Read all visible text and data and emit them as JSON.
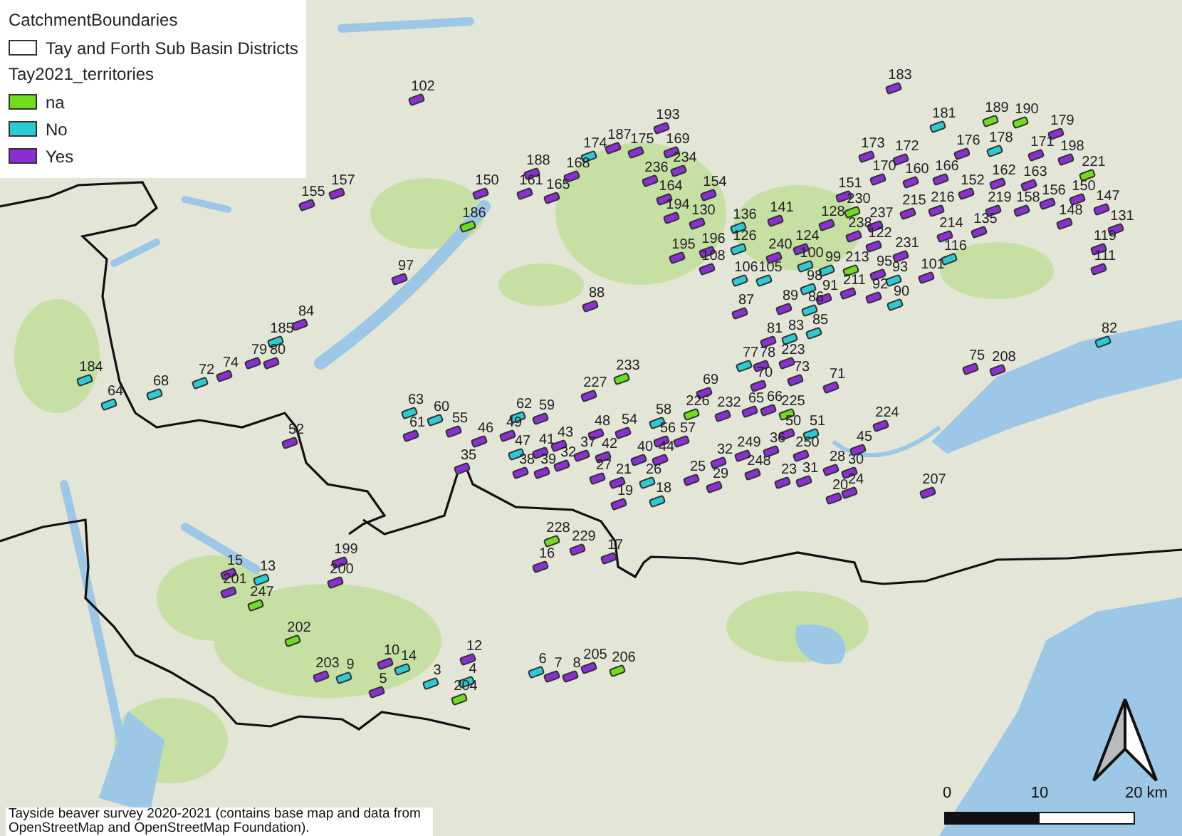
{
  "legend": {
    "title": "CatchmentBoundaries",
    "boundary_layer": "Tay and Forth Sub Basin Districts",
    "territories_layer": "Tay2021_territories",
    "entries": [
      {
        "label": "na",
        "color": "#6fdc1e"
      },
      {
        "label": "No",
        "color": "#2ccbd4"
      },
      {
        "label": "Yes",
        "color": "#8a2fd1"
      }
    ]
  },
  "territories": [
    {
      "label": "155",
      "color": "#8a2fd1"
    },
    {
      "label": "157",
      "color": "#8a2fd1"
    },
    {
      "label": "84",
      "color": "#8a2fd1"
    },
    {
      "label": "185",
      "color": "#2ccbd4"
    },
    {
      "label": "79",
      "color": "#8a2fd1"
    },
    {
      "label": "80",
      "color": "#8a2fd1"
    },
    {
      "label": "74",
      "color": "#8a2fd1"
    },
    {
      "label": "72",
      "color": "#2ccbd4"
    },
    {
      "label": "68",
      "color": "#2ccbd4"
    },
    {
      "label": "184",
      "color": "#2ccbd4"
    },
    {
      "label": "64",
      "color": "#2ccbd4"
    },
    {
      "label": "102",
      "color": "#8a2fd1"
    },
    {
      "label": "193",
      "color": "#8a2fd1"
    },
    {
      "label": "174",
      "color": "#2ccbd4"
    },
    {
      "label": "187",
      "color": "#8a2fd1"
    },
    {
      "label": "175",
      "color": "#8a2fd1"
    },
    {
      "label": "169",
      "color": "#8a2fd1"
    },
    {
      "label": "188",
      "color": "#8a2fd1"
    },
    {
      "label": "168",
      "color": "#8a2fd1"
    },
    {
      "label": "236",
      "color": "#8a2fd1"
    },
    {
      "label": "234",
      "color": "#8a2fd1"
    },
    {
      "label": "150",
      "color": "#8a2fd1"
    },
    {
      "label": "161",
      "color": "#8a2fd1"
    },
    {
      "label": "165",
      "color": "#8a2fd1"
    },
    {
      "label": "164",
      "color": "#8a2fd1"
    },
    {
      "label": "154",
      "color": "#8a2fd1"
    },
    {
      "label": "186",
      "color": "#6fdc1e"
    },
    {
      "label": "194",
      "color": "#8a2fd1"
    },
    {
      "label": "130",
      "color": "#8a2fd1"
    },
    {
      "label": "136",
      "color": "#2ccbd4"
    },
    {
      "label": "126",
      "color": "#2ccbd4"
    },
    {
      "label": "141",
      "color": "#8a2fd1"
    },
    {
      "label": "195",
      "color": "#8a2fd1"
    },
    {
      "label": "196",
      "color": "#8a2fd1"
    },
    {
      "label": "108",
      "color": "#8a2fd1"
    },
    {
      "label": "97",
      "color": "#8a2fd1"
    },
    {
      "label": "106",
      "color": "#2ccbd4"
    },
    {
      "label": "105",
      "color": "#2ccbd4"
    },
    {
      "label": "88",
      "color": "#8a2fd1"
    },
    {
      "label": "87",
      "color": "#8a2fd1"
    },
    {
      "label": "81",
      "color": "#8a2fd1"
    },
    {
      "label": "77",
      "color": "#2ccbd4"
    },
    {
      "label": "78",
      "color": "#8a2fd1"
    },
    {
      "label": "233",
      "color": "#6fdc1e"
    },
    {
      "label": "70",
      "color": "#8a2fd1"
    },
    {
      "label": "227",
      "color": "#8a2fd1"
    },
    {
      "label": "69",
      "color": "#8a2fd1"
    },
    {
      "label": "65",
      "color": "#8a2fd1"
    },
    {
      "label": "66",
      "color": "#8a2fd1"
    },
    {
      "label": "226",
      "color": "#6fdc1e"
    },
    {
      "label": "232",
      "color": "#8a2fd1"
    },
    {
      "label": "183",
      "color": "#8a2fd1"
    },
    {
      "label": "181",
      "color": "#2ccbd4"
    },
    {
      "label": "189",
      "color": "#6fdc1e"
    },
    {
      "label": "190",
      "color": "#6fdc1e"
    },
    {
      "label": "179",
      "color": "#8a2fd1"
    },
    {
      "label": "176",
      "color": "#8a2fd1"
    },
    {
      "label": "178",
      "color": "#2ccbd4"
    },
    {
      "label": "173",
      "color": "#8a2fd1"
    },
    {
      "label": "172",
      "color": "#8a2fd1"
    },
    {
      "label": "171",
      "color": "#8a2fd1"
    },
    {
      "label": "198",
      "color": "#8a2fd1"
    },
    {
      "label": "221",
      "color": "#6fdc1e"
    },
    {
      "label": "170",
      "color": "#8a2fd1"
    },
    {
      "label": "160",
      "color": "#8a2fd1"
    },
    {
      "label": "166",
      "color": "#8a2fd1"
    },
    {
      "label": "162",
      "color": "#8a2fd1"
    },
    {
      "label": "163",
      "color": "#8a2fd1"
    },
    {
      "label": "151",
      "color": "#8a2fd1"
    },
    {
      "label": "152",
      "color": "#8a2fd1"
    },
    {
      "label": "219",
      "color": "#8a2fd1"
    },
    {
      "label": "158",
      "color": "#8a2fd1"
    },
    {
      "label": "156",
      "color": "#8a2fd1"
    },
    {
      "label": "150",
      "color": "#8a2fd1"
    },
    {
      "label": "147",
      "color": "#8a2fd1"
    },
    {
      "label": "148",
      "color": "#8a2fd1"
    },
    {
      "label": "131",
      "color": "#8a2fd1"
    },
    {
      "label": "230",
      "color": "#6fdc1e"
    },
    {
      "label": "215",
      "color": "#8a2fd1"
    },
    {
      "label": "216",
      "color": "#8a2fd1"
    },
    {
      "label": "128",
      "color": "#8a2fd1"
    },
    {
      "label": "237",
      "color": "#8a2fd1"
    },
    {
      "label": "238",
      "color": "#8a2fd1"
    },
    {
      "label": "124",
      "color": "#8a2fd1"
    },
    {
      "label": "122",
      "color": "#8a2fd1"
    },
    {
      "label": "214",
      "color": "#8a2fd1"
    },
    {
      "label": "135",
      "color": "#8a2fd1"
    },
    {
      "label": "231",
      "color": "#8a2fd1"
    },
    {
      "label": "116",
      "color": "#2ccbd4"
    },
    {
      "label": "119",
      "color": "#8a2fd1"
    },
    {
      "label": "111",
      "color": "#8a2fd1"
    },
    {
      "label": "240",
      "color": "#8a2fd1"
    },
    {
      "label": "100",
      "color": "#2ccbd4"
    },
    {
      "label": "99",
      "color": "#2ccbd4"
    },
    {
      "label": "213",
      "color": "#6fdc1e"
    },
    {
      "label": "95",
      "color": "#8a2fd1"
    },
    {
      "label": "93",
      "color": "#2ccbd4"
    },
    {
      "label": "101",
      "color": "#8a2fd1"
    },
    {
      "label": "98",
      "color": "#2ccbd4"
    },
    {
      "label": "91",
      "color": "#8a2fd1"
    },
    {
      "label": "211",
      "color": "#8a2fd1"
    },
    {
      "label": "92",
      "color": "#8a2fd1"
    },
    {
      "label": "90",
      "color": "#2ccbd4"
    },
    {
      "label": "89",
      "color": "#8a2fd1"
    },
    {
      "label": "86",
      "color": "#2ccbd4"
    },
    {
      "label": "83",
      "color": "#2ccbd4"
    },
    {
      "label": "85",
      "color": "#2ccbd4"
    },
    {
      "label": "223",
      "color": "#8a2fd1"
    },
    {
      "label": "73",
      "color": "#8a2fd1"
    },
    {
      "label": "71",
      "color": "#8a2fd1"
    },
    {
      "label": "224",
      "color": "#8a2fd1"
    },
    {
      "label": "75",
      "color": "#8a2fd1"
    },
    {
      "label": "208",
      "color": "#8a2fd1"
    },
    {
      "label": "82",
      "color": "#2ccbd4"
    },
    {
      "label": "225",
      "color": "#6fdc1e"
    },
    {
      "label": "50",
      "color": "#8a2fd1"
    },
    {
      "label": "51",
      "color": "#2ccbd4"
    },
    {
      "label": "63",
      "color": "#2ccbd4"
    },
    {
      "label": "60",
      "color": "#2ccbd4"
    },
    {
      "label": "61",
      "color": "#8a2fd1"
    },
    {
      "label": "55",
      "color": "#8a2fd1"
    },
    {
      "label": "62",
      "color": "#2ccbd4"
    },
    {
      "label": "59",
      "color": "#8a2fd1"
    },
    {
      "label": "49",
      "color": "#8a2fd1"
    },
    {
      "label": "47",
      "color": "#2ccbd4"
    },
    {
      "label": "46",
      "color": "#8a2fd1"
    },
    {
      "label": "48",
      "color": "#8a2fd1"
    },
    {
      "label": "54",
      "color": "#8a2fd1"
    },
    {
      "label": "58",
      "color": "#2ccbd4"
    },
    {
      "label": "56",
      "color": "#8a2fd1"
    },
    {
      "label": "57",
      "color": "#8a2fd1"
    },
    {
      "label": "40",
      "color": "#8a2fd1"
    },
    {
      "label": "44",
      "color": "#8a2fd1"
    },
    {
      "label": "43",
      "color": "#8a2fd1"
    },
    {
      "label": "41",
      "color": "#8a2fd1"
    },
    {
      "label": "37",
      "color": "#8a2fd1"
    },
    {
      "label": "42",
      "color": "#8a2fd1"
    },
    {
      "label": "38",
      "color": "#8a2fd1"
    },
    {
      "label": "39",
      "color": "#8a2fd1"
    },
    {
      "label": "32",
      "color": "#8a2fd1"
    },
    {
      "label": "27",
      "color": "#8a2fd1"
    },
    {
      "label": "21",
      "color": "#8a2fd1"
    },
    {
      "label": "26",
      "color": "#2ccbd4"
    },
    {
      "label": "19",
      "color": "#8a2fd1"
    },
    {
      "label": "18",
      "color": "#2ccbd4"
    },
    {
      "label": "35",
      "color": "#8a2fd1"
    },
    {
      "label": "25",
      "color": "#8a2fd1"
    },
    {
      "label": "32",
      "color": "#8a2fd1"
    },
    {
      "label": "29",
      "color": "#8a2fd1"
    },
    {
      "label": "249",
      "color": "#8a2fd1"
    },
    {
      "label": "248",
      "color": "#8a2fd1"
    },
    {
      "label": "36",
      "color": "#8a2fd1"
    },
    {
      "label": "250",
      "color": "#8a2fd1"
    },
    {
      "label": "28",
      "color": "#8a2fd1"
    },
    {
      "label": "30",
      "color": "#8a2fd1"
    },
    {
      "label": "23",
      "color": "#8a2fd1"
    },
    {
      "label": "31",
      "color": "#8a2fd1"
    },
    {
      "label": "20",
      "color": "#8a2fd1"
    },
    {
      "label": "24",
      "color": "#8a2fd1"
    },
    {
      "label": "45",
      "color": "#8a2fd1"
    },
    {
      "label": "207",
      "color": "#8a2fd1"
    },
    {
      "label": "228",
      "color": "#6fdc1e"
    },
    {
      "label": "229",
      "color": "#8a2fd1"
    },
    {
      "label": "16",
      "color": "#8a2fd1"
    },
    {
      "label": "17",
      "color": "#8a2fd1"
    },
    {
      "label": "12",
      "color": "#8a2fd1"
    },
    {
      "label": "10",
      "color": "#8a2fd1"
    },
    {
      "label": "14",
      "color": "#2ccbd4"
    },
    {
      "label": "3",
      "color": "#2ccbd4"
    },
    {
      "label": "4",
      "color": "#2ccbd4"
    },
    {
      "label": "204",
      "color": "#6fdc1e"
    },
    {
      "label": "6",
      "color": "#2ccbd4"
    },
    {
      "label": "7",
      "color": "#8a2fd1"
    },
    {
      "label": "8",
      "color": "#8a2fd1"
    },
    {
      "label": "205",
      "color": "#8a2fd1"
    },
    {
      "label": "206",
      "color": "#6fdc1e"
    },
    {
      "label": "52",
      "color": "#8a2fd1"
    },
    {
      "label": "199",
      "color": "#8a2fd1"
    },
    {
      "label": "200",
      "color": "#8a2fd1"
    },
    {
      "label": "15",
      "color": "#8a2fd1"
    },
    {
      "label": "201",
      "color": "#8a2fd1"
    },
    {
      "label": "13",
      "color": "#2ccbd4"
    },
    {
      "label": "247",
      "color": "#6fdc1e"
    },
    {
      "label": "202",
      "color": "#6fdc1e"
    },
    {
      "label": "203",
      "color": "#8a2fd1"
    },
    {
      "label": "9",
      "color": "#2ccbd4"
    },
    {
      "label": "5",
      "color": "#8a2fd1"
    }
  ],
  "scale_bar": {
    "ticks": [
      "0",
      "10",
      "20 km"
    ]
  },
  "caption": "Tayside beaver survey 2020-2021 (contains base map and data from OpenStreetMap and OpenStreetMap Foundation)."
}
